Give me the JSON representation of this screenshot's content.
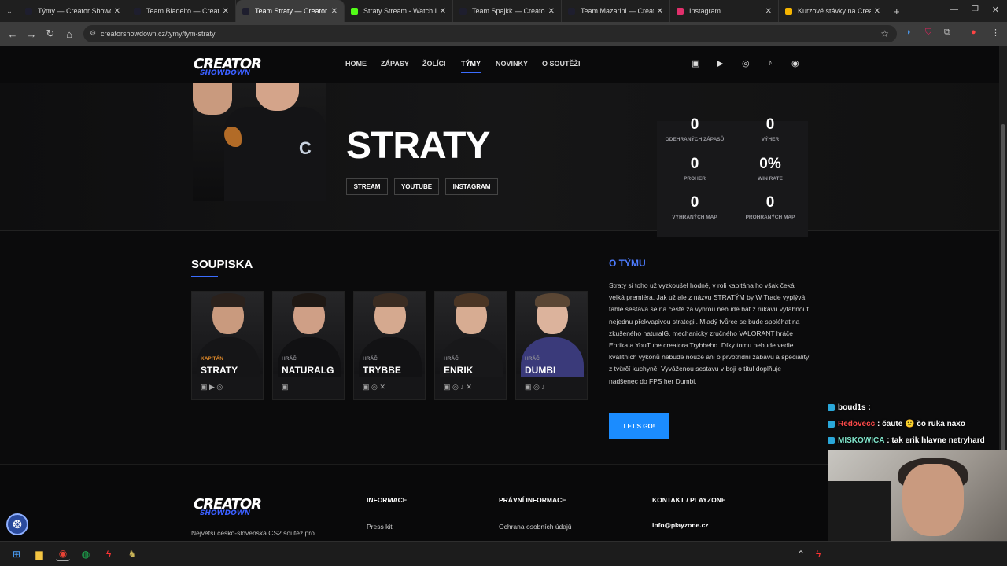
{
  "browser": {
    "tabs": [
      {
        "title": "Týmy — Creator Showdo",
        "color": "#1e1e2e"
      },
      {
        "title": "Team Bladeito — Creator",
        "color": "#1e1e2e"
      },
      {
        "title": "Team Straty — Creator Sh",
        "color": "#1e1e2e",
        "active": true
      },
      {
        "title": "Straty Stream - Watch Liv",
        "color": "#53fc18"
      },
      {
        "title": "Team Spajkk — Creator Sh",
        "color": "#1e1e2e"
      },
      {
        "title": "Team Mazarini — Creator",
        "color": "#1e1e2e"
      },
      {
        "title": "Instagram",
        "color": "#e1306c"
      },
      {
        "title": "Kurzové stávky na Creato",
        "color": "#f5b400"
      }
    ],
    "url": "creatorshowdown.cz/tymy/tym-straty"
  },
  "nav": {
    "logo": "CREATOR",
    "logo_sub": "SHOWDOWN",
    "items": [
      "HOME",
      "ZÁPASY",
      "ŽOLÍCI",
      "TÝMY",
      "NOVINKY",
      "O SOUTĚŽI"
    ],
    "social": [
      "twitch-icon",
      "youtube-icon",
      "instagram-icon",
      "tiktok-icon",
      "discord-icon"
    ]
  },
  "hero": {
    "title": "STRATY",
    "buttons": [
      "STREAM",
      "YOUTUBE",
      "INSTAGRAM"
    ],
    "stats": [
      {
        "value": "0",
        "label": "ODEHRANÝCH ZÁPASŮ"
      },
      {
        "value": "0",
        "label": "VÝHER"
      },
      {
        "value": "0",
        "label": "PROHER"
      },
      {
        "value": "0%",
        "label": "WIN RATE"
      },
      {
        "value": "0",
        "label": "VYHRANÝCH MAP"
      },
      {
        "value": "0",
        "label": "PROHRANÝCH MAP"
      }
    ]
  },
  "roster": {
    "title": "SOUPISKA",
    "players": [
      {
        "role": "KAPITÁN",
        "name": "STRATY",
        "icons": "▣ ▶ ◎",
        "skin": "#c99a7e",
        "hair": "#2a211c",
        "shirt": "#151517"
      },
      {
        "role": "HRÁČ",
        "name": "NATURALG",
        "icons": "▣",
        "skin": "#cf9f86",
        "hair": "#1e1814",
        "shirt": "#111113"
      },
      {
        "role": "HRÁČ",
        "name": "TRYBBE",
        "icons": "▣ ◎ ✕",
        "skin": "#d5a98f",
        "hair": "#3a2c22",
        "shirt": "#121214"
      },
      {
        "role": "HRÁČ",
        "name": "ENRIK",
        "icons": "▣ ◎ ♪ ✕",
        "skin": "#d7ac92",
        "hair": "#4a3524",
        "shirt": "#18181a"
      },
      {
        "role": "HRÁČ",
        "name": "DUMBI",
        "icons": "▣ ◎ ♪",
        "skin": "#dcb39c",
        "hair": "#5a4634",
        "shirt": "#3a3a7a"
      }
    ]
  },
  "about": {
    "title": "O TÝMU",
    "text": "Straty si toho už vyzkoušel hodně, v roli kapitána ho však čeká velká premiéra. Jak už ale z názvu STRATÝM by W Trade vyplývá, tahle sestava se na cestě za výhrou nebude bát z rukávu vytáhnout nejednu překvapivou strategii. Mladý tvůrce se bude spoléhat na zkušeného naturalG, mechanicky zručného VALORANT hráče Enrika a YouTube creatora Trybbeho. Díky tomu nebude vedle kvalitních výkonů nebude nouze ani o prvotřídní zábavu a speciality z tvůrčí kuchyně. Vyváženou sestavu v boji o titul doplňuje nadšenec do FPS her Dumbi.",
    "button": "LET'S GO!"
  },
  "footer": {
    "tagline": "Největší česko-slovenská CS2 soutěž pro",
    "col1_title": "INFORMACE",
    "col1_link": "Press kit",
    "col2_title": "PRÁVNÍ INFORMACE",
    "col2_link": "Ochrana osobních údajů",
    "col3_title": "KONTAKT / PLAYZONE",
    "col3_link": "info@playzone.cz"
  },
  "chat": [
    {
      "user": "boud1s",
      "msg": "",
      "color": "#ffffff"
    },
    {
      "user": "Redovecc",
      "msg": "čaute 🙂 čo ruka naxo",
      "color": "#ff4b4b"
    },
    {
      "user": "MISKOWICA",
      "msg": "tak erik hlavne netryhard",
      "color": "#7fe3c9"
    }
  ]
}
